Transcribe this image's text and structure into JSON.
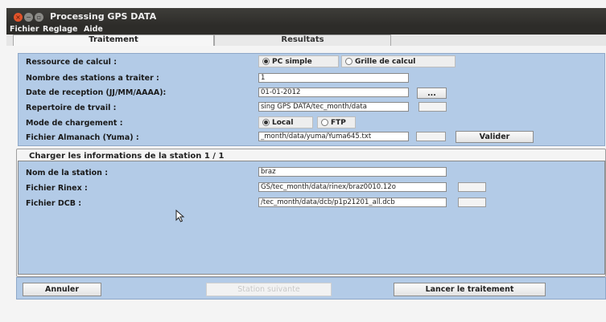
{
  "window": {
    "title": "Processing GPS DATA"
  },
  "menu": [
    "Fichier",
    "Reglage",
    "Aide"
  ],
  "tabs": {
    "active": "Traitement",
    "inactive": "Resultats"
  },
  "form": {
    "ressource_label": "Ressource de calcul :",
    "ressource_option_1": "PC simple",
    "ressource_option_2": "Grille de calcul",
    "ressource_selected": "PC simple",
    "nb_stations_label": "Nombre des stations a traiter :",
    "nb_stations_value": "1",
    "date_label": "Date de reception (JJ/MM/AAAA):",
    "date_value": "01-01-2012",
    "date_button": "...",
    "repertoire_label": "Repertoire de trvail :",
    "repertoire_value": "sing GPS DATA/tec_month/data",
    "mode_label": "Mode de chargement :",
    "mode_option_1": "Local",
    "mode_option_2": "FTP",
    "mode_selected": "Local",
    "almanach_label": "Fichier Almanach (Yuma) :",
    "almanach_value": "_month/data/yuma/Yuma645.txt",
    "valider_button": "Valider"
  },
  "station": {
    "group_title": "Charger les informations de la station 1 / 1",
    "nom_label": "Nom de la station :",
    "nom_value": "braz",
    "rinex_label": "Fichier Rinex :",
    "rinex_value": "GS/tec_month/data/rinex/braz0010.12o",
    "dcb_label": "Fichier DCB :",
    "dcb_value": "/tec_month/data/dcb/p1p21201_all.dcb"
  },
  "actions": {
    "annuler": "Annuler",
    "station_suivante": "Station suivante",
    "lancer": "Lancer le traitement"
  }
}
